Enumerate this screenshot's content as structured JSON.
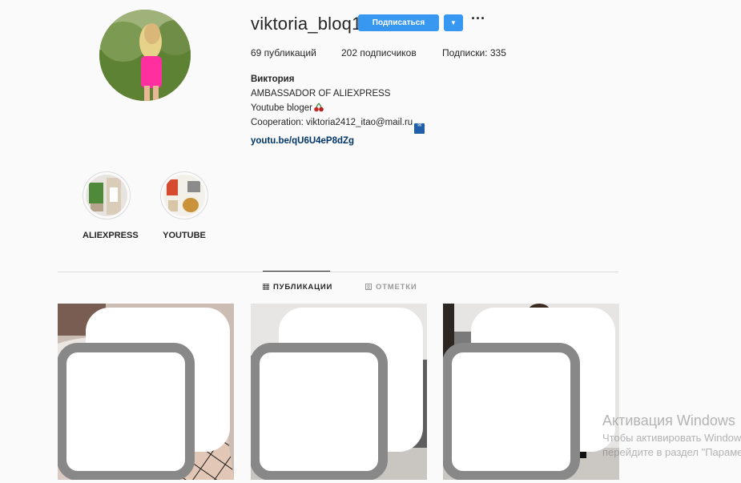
{
  "profile": {
    "username": "viktoria_bloq1",
    "follow_label": "Подписаться",
    "dropdown_icon": "chevron-down-icon",
    "more_label": "···",
    "stats": {
      "posts": "69 публикаций",
      "followers": "202 подписчиков",
      "following": "Подписки: 335"
    },
    "bio": {
      "name": "Виктория",
      "line1": "AMBASSADOR OF ALIEXPRESS",
      "line2": "Youtube bloger",
      "line3": "Cooperation: viktoria2412_itao@mail.ru",
      "link": "youtu.be/qU6U4eP8dZg"
    }
  },
  "highlights": [
    {
      "label": "ALIEXPRESS"
    },
    {
      "label": "YOUTUBE"
    }
  ],
  "tabs": {
    "posts": "ПУБЛИКАЦИИ",
    "tagged": "ОТМЕТКИ"
  },
  "posts": [
    {
      "icon": "multiple-photos-icon"
    },
    {
      "icon": "multiple-photos-icon"
    },
    {
      "icon": "multiple-photos-icon"
    }
  ],
  "watermark": {
    "line1": "Активация Windows",
    "line2": "Чтобы активировать Windows,",
    "line3": "перейдите в раздел \"Параметры\"."
  },
  "colors": {
    "accent": "#3897f0",
    "link": "#003569",
    "text": "#262626",
    "background": "#fafafa"
  }
}
